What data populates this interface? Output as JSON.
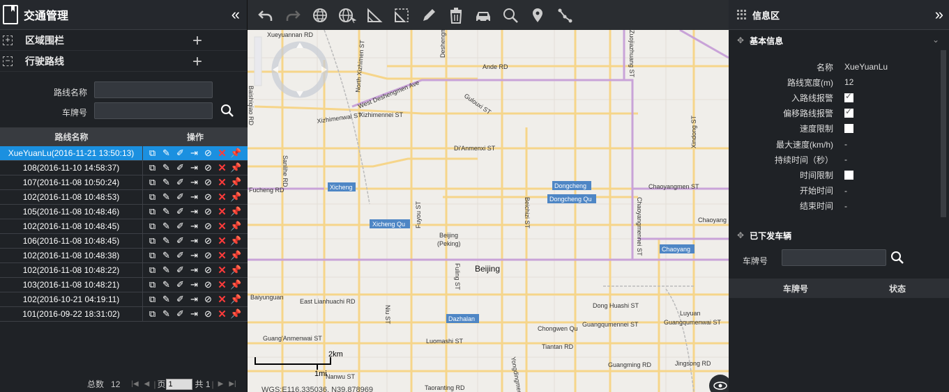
{
  "left": {
    "title": "交通管理",
    "collapse_icon": "«",
    "sections": [
      {
        "toggle": "+",
        "label": "区域围栏",
        "action": "+"
      },
      {
        "toggle": "−",
        "label": "行驶路线",
        "action": "+"
      }
    ],
    "form": {
      "route_name_label": "路线名称",
      "route_name_value": "",
      "plate_label": "车牌号",
      "plate_value": ""
    },
    "table": {
      "headers": [
        "路线名称",
        "操作"
      ],
      "rows": [
        "XueYuanLu(2016-11-21 13:50:13)",
        "108(2016-11-10 14:58:37)",
        "107(2016-11-08 10:50:24)",
        "102(2016-11-08 10:48:53)",
        "105(2016-11-08 10:48:46)",
        "102(2016-11-08 10:48:45)",
        "106(2016-11-08 10:48:45)",
        "102(2016-11-08 10:48:38)",
        "102(2016-11-08 10:48:22)",
        "103(2016-11-08 10:48:21)",
        "102(2016-10-21 04:19:11)",
        "101(2016-09-22 18:31:02)"
      ],
      "selected_index": 0
    },
    "pager": {
      "total_label": "总数",
      "total_value": "12",
      "page_label": "页",
      "page_value": "1",
      "of_label": "共 1"
    }
  },
  "map": {
    "labels": {
      "xueyuannan": "Xueyuannan RD",
      "deshengmen": "Deshengmen",
      "zuojiazhuang": "Zuojiazhuang ST",
      "ande": "Ande RD",
      "north_xizhimen": "North Xizhimen ST",
      "west_deshengmen": "West Deshengmen Ave",
      "guloxi": "Gulouxi ST",
      "baishiqiao": "Baishiqiao RD",
      "xizhimenwai": "Xizhimenwai ST",
      "xizhimennei": "Xizhimennei ST",
      "di_anmen": "Di'Anmenxi ST",
      "xindong": "Xindong ST",
      "sanlihe": "Sanlihe RD",
      "fucheng": "Fucheng RD",
      "xicheng": "Xicheng",
      "dongcheng": "Dongcheng",
      "dongcheng_qu": "Dongcheng Qu",
      "chaoyangmennei": "Chaoyangmennei ST",
      "chaoyangmen_s": "Chaoyangmen ST",
      "beichizi": "Beichizi ST",
      "fuyou": "Fuyou ST",
      "xicheng_qu": "Xicheng Qu",
      "beijing_peking_1": "Beijing",
      "beijing_peking_2": "(Peking)",
      "chaoyang_partial": "Chaoyang",
      "chaoyang": "Chaoyang",
      "beijing": "Beijing",
      "baiyunguan": "Baiyunguan",
      "east_lianhuachi": "East Lianhuachi RD",
      "fuling": "Fuling ST",
      "niu": "Niu ST",
      "dong_huashi": "Dong Huashi ST",
      "luyuan": "Luyuan",
      "dazhalan": "Dazhalan",
      "chongwen_qu": "Chongwen Qu",
      "guangqumennei": "Guangqumennei ST",
      "guangqumenwai": "Guangqumenwai ST",
      "guang_anmenwai": "Guang'Anmenwai ST",
      "luomashi": "Luomashi ST",
      "tiantan": "Tiantan RD",
      "guangming": "Guangming RD",
      "jingsong": "Jingsong RD",
      "yongdingmen": "Yongdingmen",
      "nanwu": "Nanwu ST",
      "taoranting": "Taoranting RD",
      "scale_km": "2km",
      "scale_mi": "1mi",
      "coords": "WGS:E116.335036, N39.878969"
    }
  },
  "right": {
    "title": "信息区",
    "expand_icon": "»",
    "basic_title": "基本信息",
    "fields": [
      {
        "key": "名称",
        "type": "text",
        "value": "XueYuanLu"
      },
      {
        "key": "路线宽度(m)",
        "type": "text",
        "value": "12"
      },
      {
        "key": "入路线报警",
        "type": "checkbox",
        "checked": true
      },
      {
        "key": "偏移路线报警",
        "type": "checkbox",
        "checked": true
      },
      {
        "key": "速度限制",
        "type": "checkbox",
        "checked": false
      },
      {
        "key": "最大速度(km/h)",
        "type": "text",
        "value": "-"
      },
      {
        "key": "持续时间（秒）",
        "type": "text",
        "value": "-"
      },
      {
        "key": "时间限制",
        "type": "checkbox",
        "checked": false
      },
      {
        "key": "开始时间",
        "type": "text",
        "value": "-"
      },
      {
        "key": "结束时间",
        "type": "text",
        "value": "-"
      }
    ],
    "vehicles_title": "已下发车辆",
    "vehicle_plate_label": "车牌号",
    "vehicle_plate_value": "",
    "vehicle_headers": [
      "车牌号",
      "状态"
    ]
  },
  "colors": {
    "selected_row": "#1b90e0",
    "delete_red": "#ff3b3b",
    "panel_bg": "#1f2226",
    "map_road": "#f6d58a",
    "map_ring": "#c9a3d8",
    "map_bg": "#f0eeea"
  }
}
